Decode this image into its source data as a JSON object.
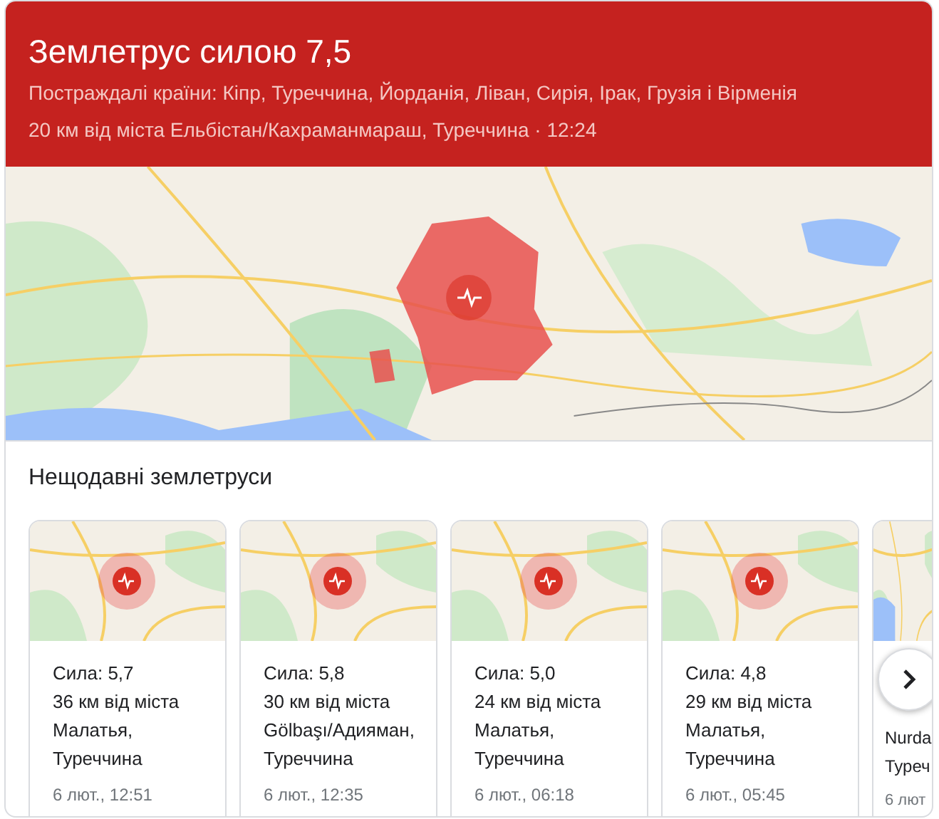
{
  "header": {
    "title": "Землетрус силою 7,5",
    "affected": "Постраждалі країни: Кіпр, Туреччина, Йорданія, Ліван, Сирія, Ірак, Грузія і Вірменія",
    "location": "20 км від міста Ельбістан/Кахраманмараш, Туреччина · 12:24"
  },
  "recent": {
    "heading": "Нещодавні землетруси",
    "cards": [
      {
        "magnitude": "Сила: 5,7",
        "place": "36 км від міста Малатья, Туреччина",
        "time": "6 лют., 12:51"
      },
      {
        "magnitude": "Сила: 5,8",
        "place": "30 км від міста Gölbaşı/Адияман, Туреччина",
        "time": "6 лют., 12:35"
      },
      {
        "magnitude": "Сила: 5,0",
        "place": "24 км від міста Малатья, Туреччина",
        "time": "6 лют., 06:18"
      },
      {
        "magnitude": "Сила: 4,8",
        "place": "29 км від міста Малатья, Туреччина",
        "time": "6 лют., 05:45"
      },
      {
        "kind": "partial",
        "lines": [
          "Nurda",
          "Туреч"
        ],
        "time": "6 лют"
      }
    ]
  }
}
